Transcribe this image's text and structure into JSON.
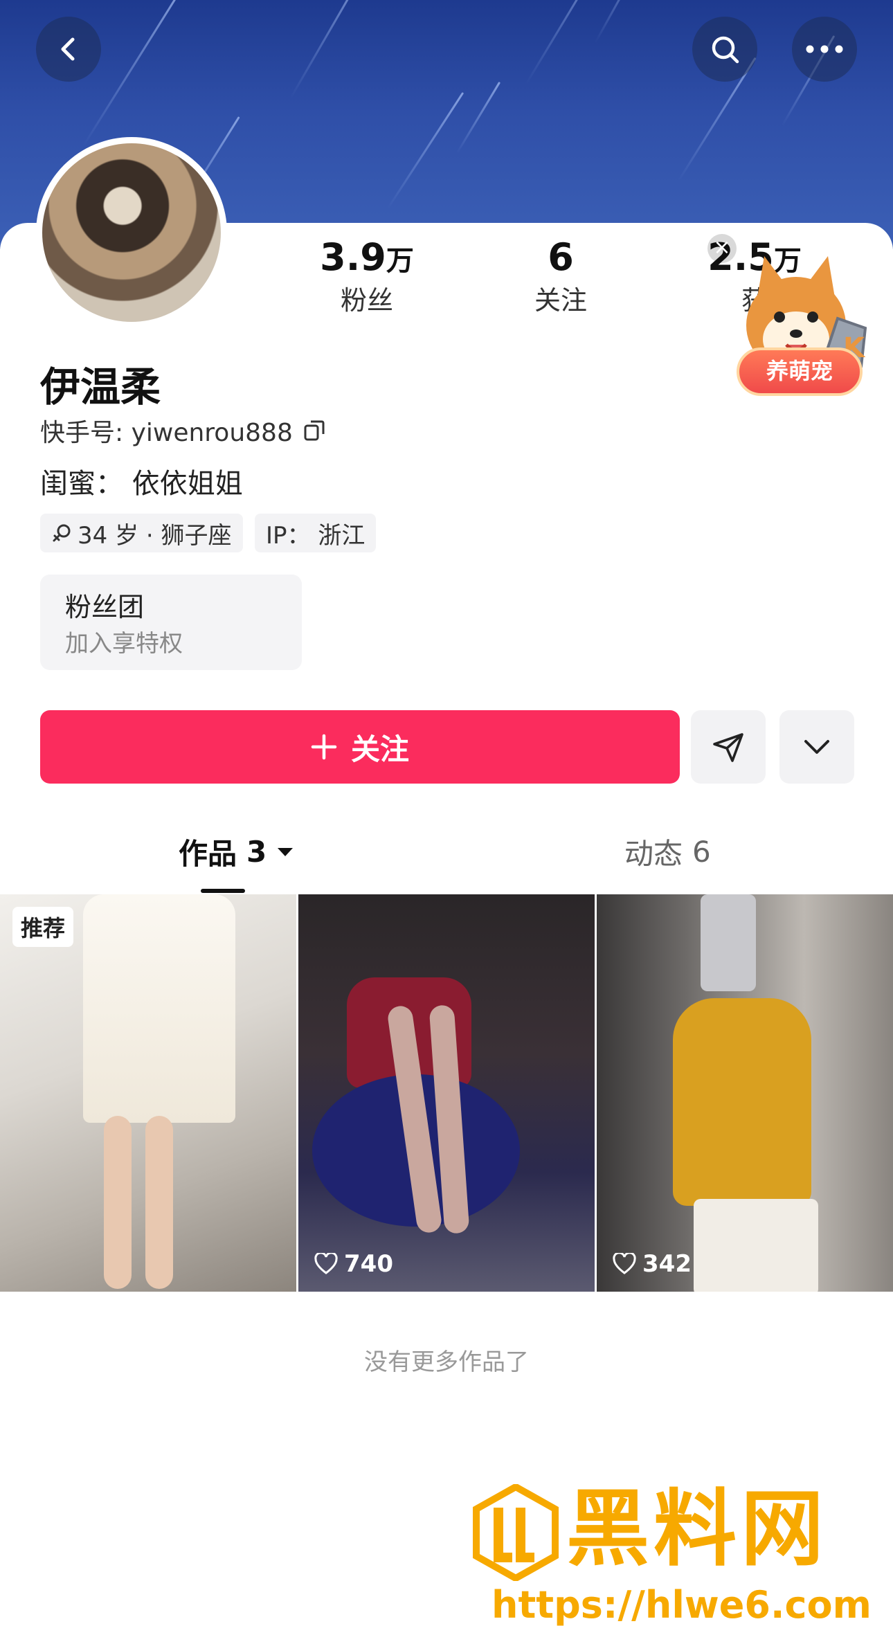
{
  "header": {
    "back_icon": "chevron-left-icon",
    "search_icon": "search-icon",
    "more_icon": "more-dots-icon"
  },
  "profile": {
    "stats": [
      {
        "num": "3.9",
        "unit": "万",
        "label": "粉丝"
      },
      {
        "num": "6",
        "unit": "",
        "label": "关注"
      },
      {
        "num": "2.5",
        "unit": "万",
        "label": "获"
      }
    ],
    "pet_badge": "养萌宠",
    "name": "伊温柔",
    "kuaishou_id": "快手号: yiwenrou888",
    "bestie": "闺蜜：  依依姐姐",
    "tags": [
      "34 岁 · 狮子座",
      "IP：  浙江"
    ],
    "fanclub": {
      "title": "粉丝团",
      "subtitle": "加入享特权"
    }
  },
  "actions": {
    "follow_label": "关注",
    "share_icon": "send-icon",
    "expand_icon": "chevron-down-icon"
  },
  "tabs": [
    {
      "label": "作品",
      "count": "3"
    },
    {
      "label": "动态",
      "count": "6"
    }
  ],
  "works": [
    {
      "badge": "推荐",
      "likes": ""
    },
    {
      "badge": "",
      "likes": "740"
    },
    {
      "badge": "",
      "likes": "342"
    }
  ],
  "end_text": "没有更多作品了",
  "watermark": {
    "brand": "黑料网",
    "url": "https://hlwe6.com"
  },
  "colors": {
    "accent": "#fb2c5d",
    "watermark": "#f7a900",
    "hero": "#2f4fa8"
  }
}
